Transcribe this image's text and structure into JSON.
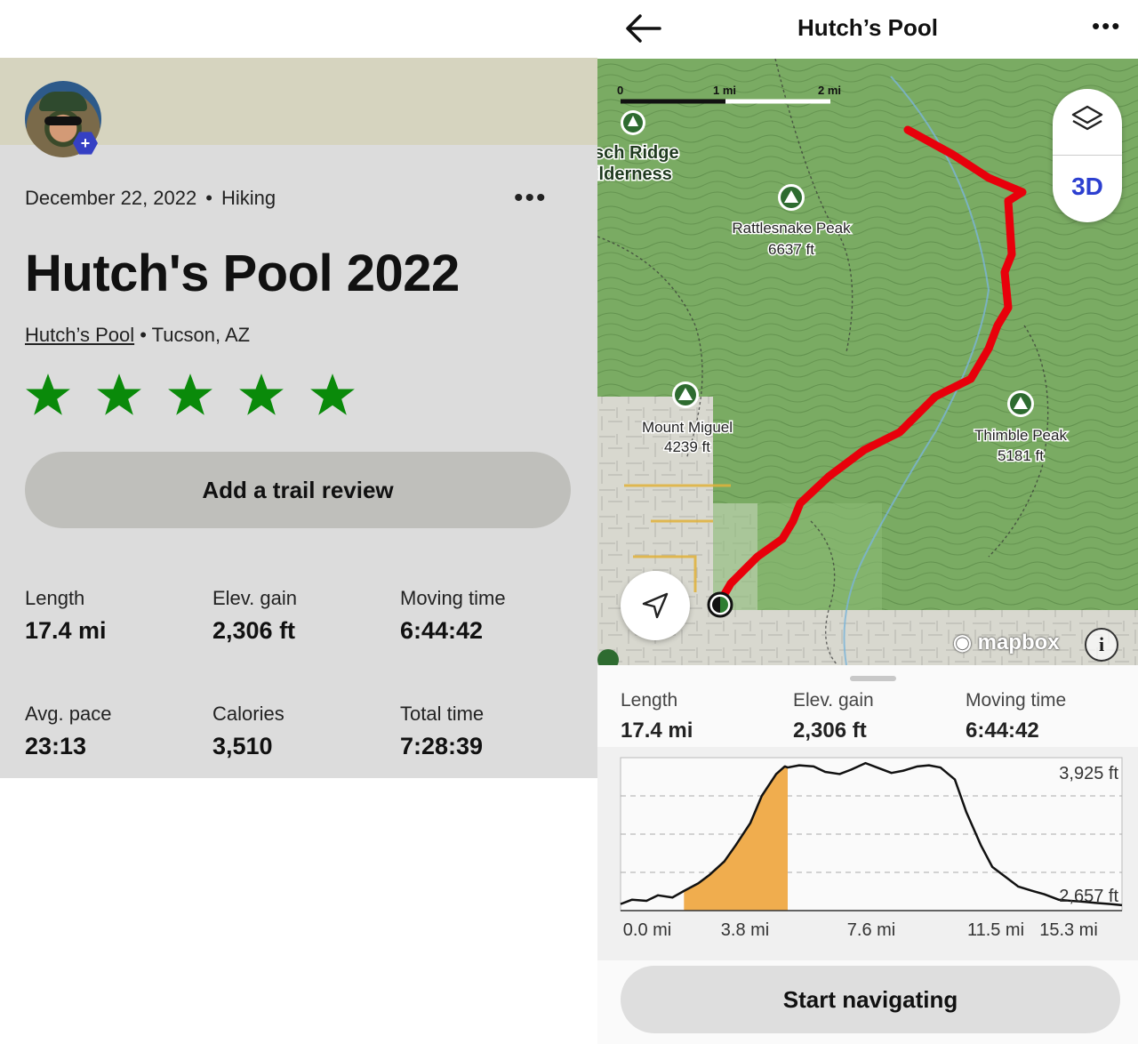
{
  "activity": {
    "date": "December 22, 2022",
    "activity_type": "Hiking",
    "title": "Hutch's Pool 2022",
    "trail_name": "Hutch’s Pool",
    "location": "Tucson, AZ",
    "rating": 5,
    "review_button": "Add a trail review",
    "stats": [
      {
        "label": "Length",
        "value": "17.4 mi"
      },
      {
        "label": "Elev. gain",
        "value": "2,306 ft"
      },
      {
        "label": "Moving time",
        "value": "6:44:42"
      },
      {
        "label": "Avg. pace",
        "value": "23:13"
      },
      {
        "label": "Calories",
        "value": "3,510"
      },
      {
        "label": "Total time",
        "value": "7:28:39"
      }
    ]
  },
  "map_screen": {
    "title": "Hutch’s Pool",
    "layers_icon": "layers-icon",
    "toggle_3d": "3D",
    "attribution": "mapbox",
    "info": "i",
    "scale": [
      "0",
      "1 mi",
      "2 mi"
    ],
    "labels": {
      "wilderness_1": "sch Ridge",
      "wilderness_2": "ilderness",
      "rattlesnake_name": "Rattlesnake Peak",
      "rattlesnake_elev": "6637 ft",
      "miguel_name": "Mount Miguel",
      "miguel_elev": "4239 ft",
      "thimble_name": "Thimble Peak",
      "thimble_elev": "5181 ft"
    },
    "stats": [
      {
        "label": "Length",
        "value": "17.4 mi"
      },
      {
        "label": "Elev. gain",
        "value": "2,306 ft"
      },
      {
        "label": "Moving time",
        "value": "6:44:42"
      }
    ],
    "navigate_button": "Start navigating",
    "colors": {
      "route": "#e8000b",
      "terrain": "#6fa35a",
      "profile_highlight": "#f0ad4e",
      "accent": "#2c3fd0",
      "star": "#0a8a0a"
    }
  },
  "chart_data": {
    "type": "area",
    "xlabel": "",
    "ylabel": "",
    "x_tick_labels": [
      "0.0 mi",
      "3.8 mi",
      "7.6 mi",
      "11.5 mi",
      "15.3 mi"
    ],
    "y_tick_labels": [
      "3,925 ft",
      "2,657 ft"
    ],
    "ylim": [
      2600,
      4000
    ],
    "xlim": [
      0,
      17.4
    ],
    "highlight_range_mi": [
      2.0,
      5.8
    ],
    "x": [
      0,
      0.4,
      0.9,
      1.3,
      1.8,
      2.2,
      2.7,
      3.1,
      3.6,
      4.0,
      4.5,
      4.9,
      5.4,
      5.7,
      5.8,
      6.2,
      6.7,
      7.1,
      7.6,
      8.0,
      8.5,
      8.9,
      9.4,
      9.8,
      10.3,
      10.7,
      11.1,
      11.6,
      12.0,
      12.5,
      12.9,
      13.4,
      13.8,
      14.3,
      14.7,
      15.2,
      15.6,
      16.1,
      16.5,
      17.0,
      17.4
    ],
    "y": [
      2660,
      2700,
      2690,
      2740,
      2720,
      2780,
      2850,
      2930,
      3050,
      3200,
      3400,
      3650,
      3850,
      3920,
      3910,
      3930,
      3920,
      3870,
      3850,
      3890,
      3950,
      3910,
      3860,
      3880,
      3920,
      3930,
      3910,
      3800,
      3500,
      3200,
      3000,
      2900,
      2820,
      2780,
      2750,
      2700,
      2690,
      2680,
      2670,
      2660,
      2650
    ]
  }
}
